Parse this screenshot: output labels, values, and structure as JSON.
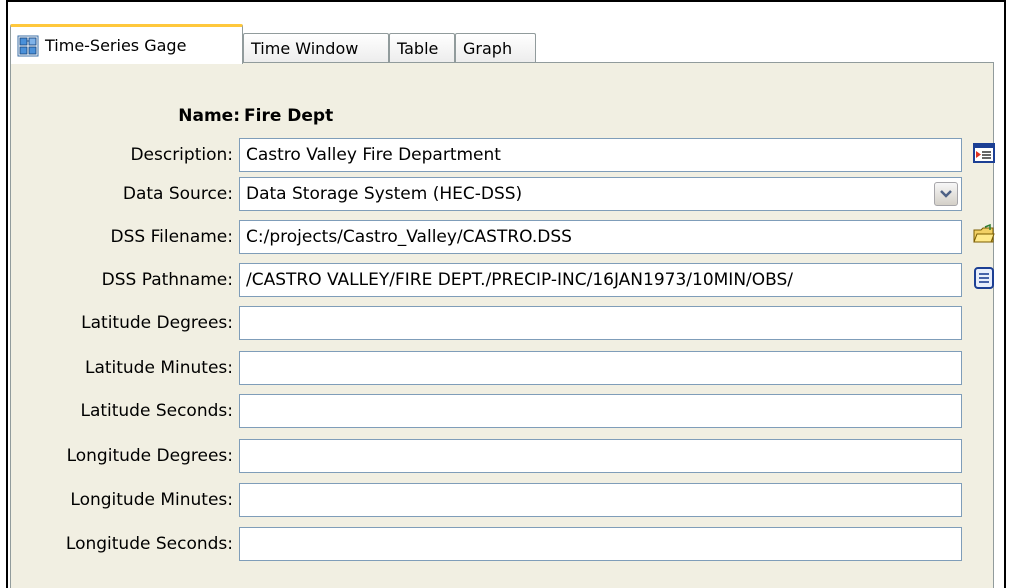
{
  "tabs": [
    {
      "label": "Time-Series Gage",
      "icon": "gage-icon",
      "active": true
    },
    {
      "label": "Time Window",
      "active": false
    },
    {
      "label": "Table",
      "active": false
    },
    {
      "label": "Graph",
      "active": false
    }
  ],
  "form": {
    "name_label": "Name:",
    "name_value": "Fire Dept",
    "description_label": "Description:",
    "description_value": "Castro Valley Fire Department",
    "data_source_label": "Data Source:",
    "data_source_value": "Data Storage System (HEC-DSS)",
    "dss_filename_label": "DSS Filename:",
    "dss_filename_value": "C:/projects/Castro_Valley/CASTRO.DSS",
    "dss_pathname_label": "DSS Pathname:",
    "dss_pathname_value": "/CASTRO VALLEY/FIRE DEPT./PRECIP-INC/16JAN1973/10MIN/OBS/",
    "latitude_degrees_label": "Latitude Degrees:",
    "latitude_degrees_value": "",
    "latitude_minutes_label": "Latitude Minutes:",
    "latitude_minutes_value": "",
    "latitude_seconds_label": "Latitude Seconds:",
    "latitude_seconds_value": "",
    "longitude_degrees_label": "Longitude Degrees:",
    "longitude_degrees_value": "",
    "longitude_minutes_label": "Longitude Minutes:",
    "longitude_minutes_value": "",
    "longitude_seconds_label": "Longitude Seconds:",
    "longitude_seconds_value": ""
  },
  "icons": {
    "description_button": "edit-description-icon",
    "data_source_dropdown": "chevron-down-icon",
    "filename_button": "open-folder-icon",
    "pathname_button": "select-pathname-icon"
  },
  "colors": {
    "active_tab_accent": "#ffc83c",
    "panel_background": "#f1efe2",
    "field_border": "#7f9db9"
  }
}
